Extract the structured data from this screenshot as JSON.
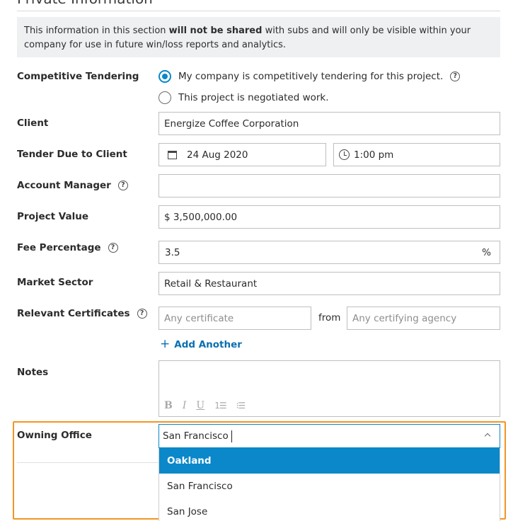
{
  "section": {
    "title": "Private Information",
    "notice": {
      "part1": "This information in this section ",
      "bold": "will not be shared",
      "part2": " with subs and will only be visible within your company for use in future win/loss reports and analytics."
    }
  },
  "competitive_tendering": {
    "label": "Competitive Tendering",
    "options": [
      {
        "label": "My company is competitively tendering for this project.",
        "checked": true,
        "help": "?"
      },
      {
        "label": "This project is negotiated work.",
        "checked": false
      }
    ]
  },
  "client": {
    "label": "Client",
    "value": "Energize Coffee Corporation"
  },
  "tender_due": {
    "label": "Tender Due to Client",
    "date": "24 Aug 2020",
    "time": "1:00 pm"
  },
  "account_manager": {
    "label": "Account Manager",
    "help": "?",
    "value": ""
  },
  "project_value": {
    "label": "Project Value",
    "value": "$ 3,500,000.00"
  },
  "fee_percentage": {
    "label": "Fee Percentage",
    "help": "?",
    "value": "3.5",
    "suffix": "%"
  },
  "market_sector": {
    "label": "Market Sector",
    "value": "Retail & Restaurant"
  },
  "relevant_certificates": {
    "label": "Relevant Certificates",
    "help": "?",
    "certificate_placeholder": "Any certificate",
    "from_text": "from",
    "agency_placeholder": "Any certifying agency",
    "add_another": "Add Another",
    "add_icon": "+"
  },
  "notes": {
    "label": "Notes",
    "toolbar": {
      "bold": "B",
      "italic": "I",
      "underline": "U",
      "ordered_list": "1☰",
      "bullet_list": "⁝☰"
    }
  },
  "owning_office": {
    "label": "Owning Office",
    "input_value": "San Francisco",
    "options": [
      "Oakland",
      "San Francisco",
      "San Jose"
    ],
    "highlighted": "Oakland"
  },
  "colors": {
    "accent": "#0a88c9",
    "link": "#0a6fb0",
    "focus_outline": "#f29524"
  },
  "icons": {
    "date": "calendar-icon",
    "time": "clock-icon",
    "dropdown": "chevron-up-icon"
  }
}
